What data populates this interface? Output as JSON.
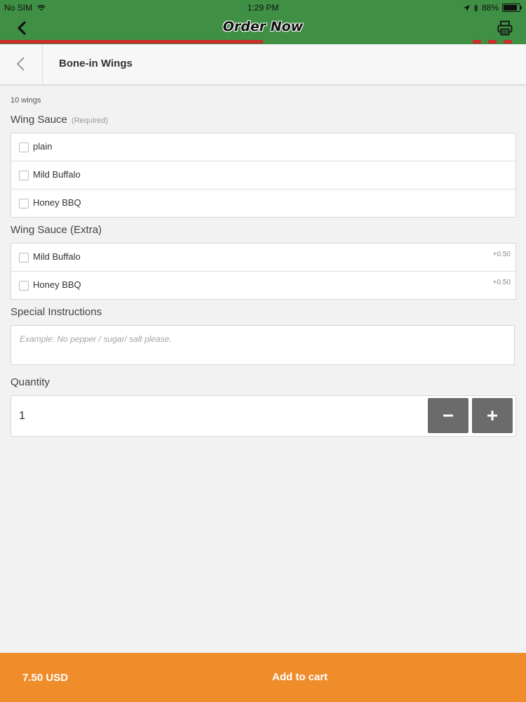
{
  "status_bar": {
    "carrier": "No SIM",
    "time": "1:29 PM",
    "battery": "88%",
    "battery_level": 0.88
  },
  "app_header": {
    "title": "Order Now",
    "progress": 0.5,
    "colors": {
      "background": "#3f8f45",
      "progress": "#cf2b2b"
    }
  },
  "item": {
    "title": "Bone-in Wings",
    "subtitle": "10 wings"
  },
  "sections": {
    "wing_sauce": {
      "label": "Wing Sauce",
      "required_note": "(Required)",
      "options": [
        {
          "label": "plain",
          "checked": false
        },
        {
          "label": "Mild Buffalo",
          "checked": false
        },
        {
          "label": "Honey BBQ",
          "checked": false
        }
      ]
    },
    "wing_sauce_extra": {
      "label": "Wing Sauce (Extra)",
      "options": [
        {
          "label": "Mild Buffalo",
          "price": "+0.50",
          "checked": false
        },
        {
          "label": "Honey BBQ",
          "price": "+0.50",
          "checked": false
        }
      ]
    },
    "special_instructions": {
      "label": "Special Instructions",
      "placeholder": "Example: No pepper / sugar/ salt please."
    },
    "quantity": {
      "label": "Quantity",
      "value": "1"
    }
  },
  "footer": {
    "price": "7.50 USD",
    "add_to_cart": "Add to cart",
    "color": "#ef8d2b"
  },
  "icons": [
    "wifi-icon",
    "location-arrow-icon",
    "bluetooth-icon",
    "battery-icon",
    "back-chevron-icon",
    "printer-icon",
    "minus-icon",
    "plus-icon"
  ]
}
